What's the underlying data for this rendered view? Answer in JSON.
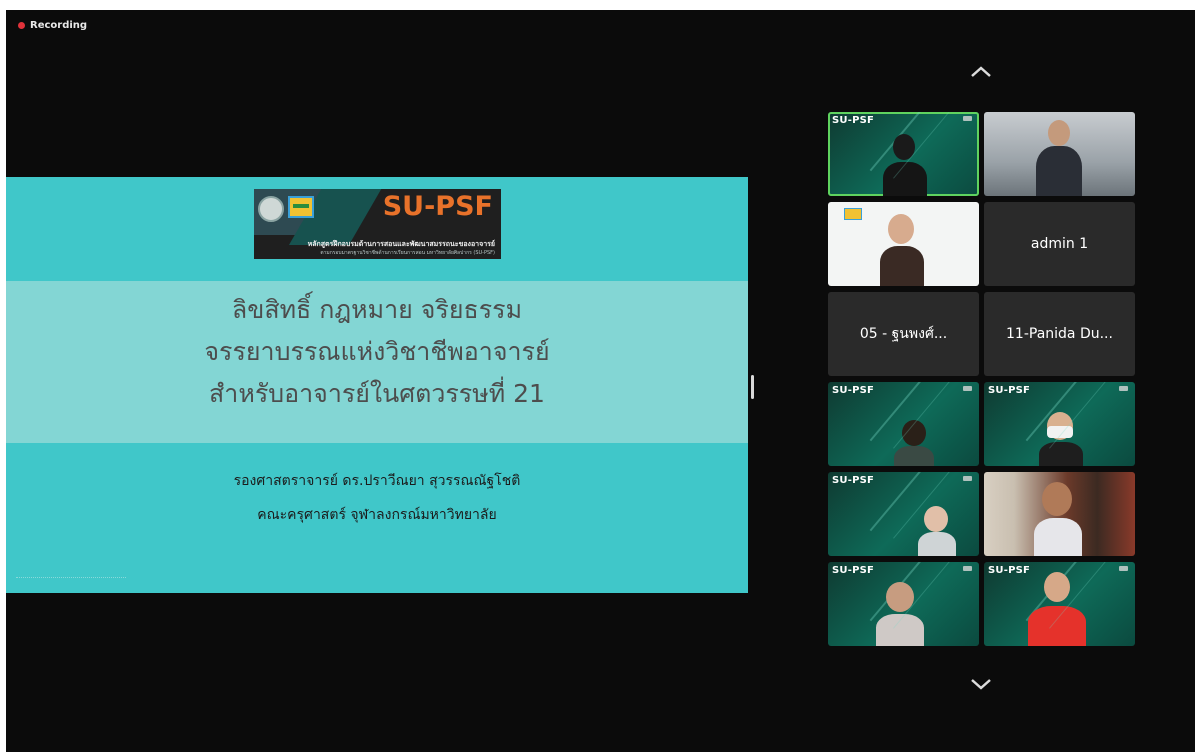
{
  "recording": {
    "label": "Recording",
    "color": "#e0323a"
  },
  "slide": {
    "logo_title": "SU-PSF",
    "logo_subtitle": "หลักสูตรฝึกอบรมด้านการสอนและพัฒนาสมรรถนะของอาจารย์",
    "logo_subtitle2": "ตามกรอบมาตรฐานวิชาชีพด้านการเรียนการสอน มหาวิทยาลัยศิลปากร (SU-PSF)",
    "title_lines": [
      "ลิขสิทธิ์ กฎหมาย จริยธรรม",
      "จรรยาบรรณแห่งวิชาชีพอาจารย์",
      "สำหรับอาจารย์ในศตวรรษที่ 21"
    ],
    "author_lines": [
      "รองศาสตราจารย์ ดร.ปราวีณยา สุวรรณณัฐโชติ",
      "คณะครุศาสตร์ จุฬาลงกรณ์มหาวิทยาลัย"
    ],
    "accent": "#40c7c9"
  },
  "gallery": {
    "scroll_up_icon": "chevron-up-icon",
    "scroll_down_icon": "chevron-down-icon",
    "tiles": [
      {
        "tag": "SU-PSF",
        "name": "",
        "style": "green",
        "active": true
      },
      {
        "tag": "",
        "name": "",
        "style": "office",
        "active": false
      },
      {
        "tag": "",
        "name": "",
        "style": "white",
        "active": false
      },
      {
        "tag": "",
        "name": "admin 1",
        "style": "dark",
        "active": false
      },
      {
        "tag": "",
        "name": "05 - ฐนพงศ์...",
        "style": "dark",
        "active": false
      },
      {
        "tag": "",
        "name": "11-Panida Du...",
        "style": "dark",
        "active": false
      },
      {
        "tag": "SU-PSF",
        "name": "",
        "style": "green",
        "active": false
      },
      {
        "tag": "SU-PSF",
        "name": "",
        "style": "green",
        "active": false
      },
      {
        "tag": "SU-PSF",
        "name": "",
        "style": "green",
        "active": false
      },
      {
        "tag": "",
        "name": "",
        "style": "library",
        "active": false
      },
      {
        "tag": "SU-PSF",
        "name": "",
        "style": "green",
        "active": false
      },
      {
        "tag": "SU-PSF",
        "name": "",
        "style": "green",
        "active": false
      }
    ]
  }
}
